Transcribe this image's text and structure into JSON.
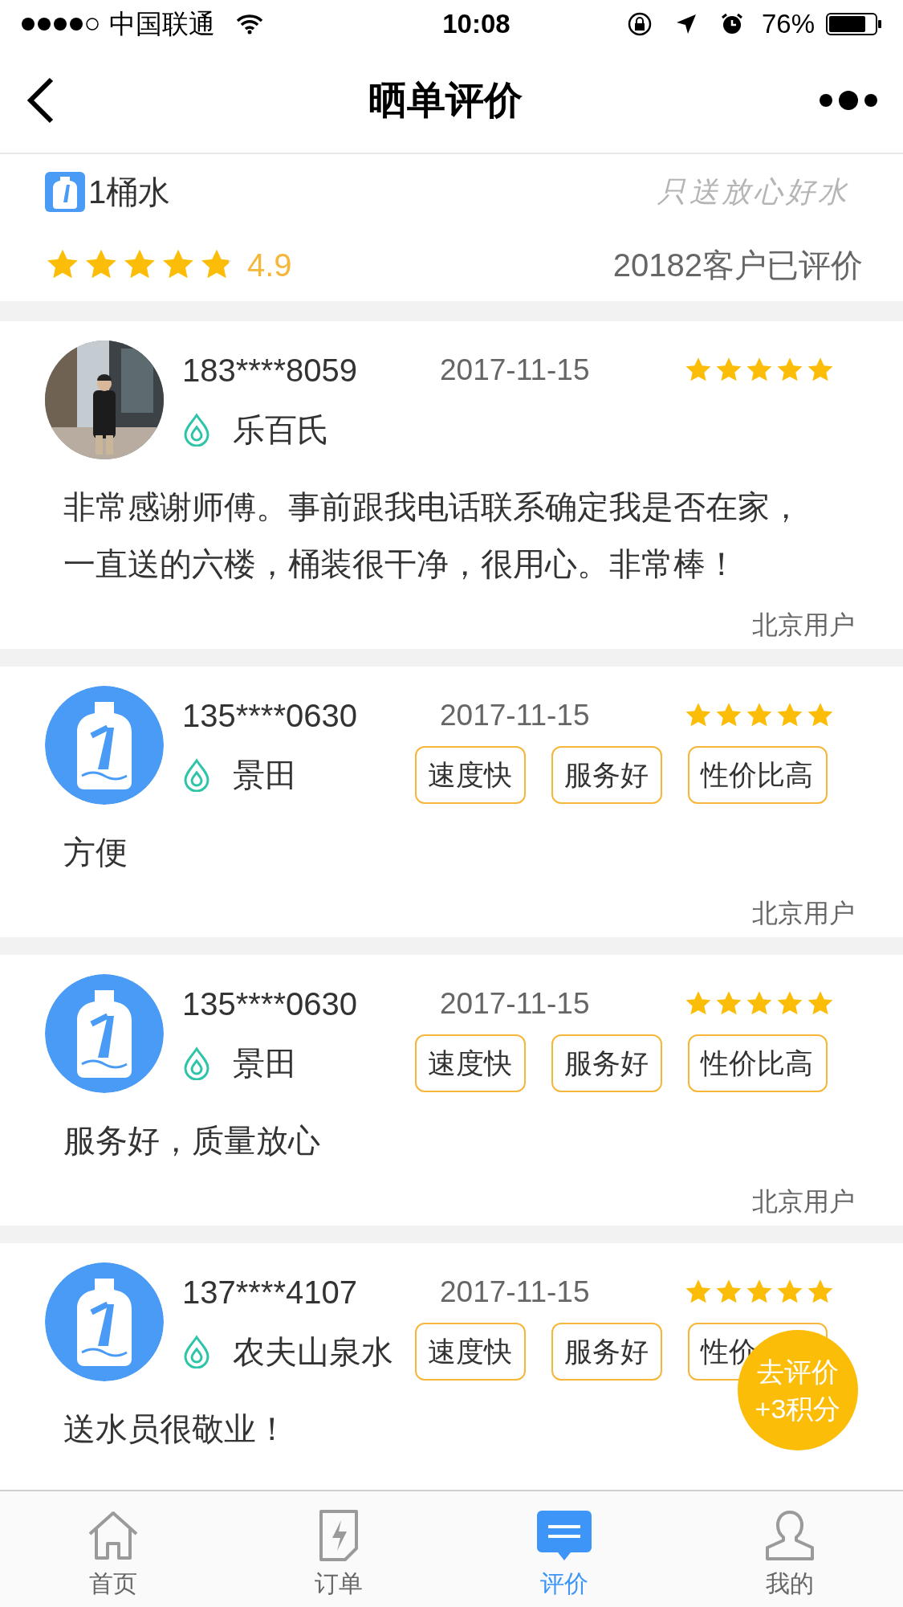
{
  "status_bar": {
    "carrier": "中国联通",
    "time": "10:08",
    "battery": "76%"
  },
  "nav": {
    "title": "晒单评价"
  },
  "shop": {
    "name": "1桶水",
    "slogan": "只送放心好水",
    "stars": 4.9,
    "rating": "4.9",
    "review_count": "20182客户已评价"
  },
  "reviews": [
    {
      "phone": "183****8059",
      "date": "2017-11-15",
      "stars": 5,
      "brand": "乐百氏",
      "comment": "非常感谢师傅。事前跟我电话联系确定我是否在家，一直送的六楼，桶装很干净，很用心。非常棒！",
      "location": "北京用户"
    },
    {
      "avatar": {
        "kind": "logo"
      },
      "phone": "135****0630",
      "date": "2017-11-15",
      "stars": 5,
      "brand": "景田",
      "tags": [
        "速度快",
        "服务好",
        "性价比高"
      ],
      "comment": "方便",
      "location": "北京用户"
    },
    {
      "avatar": {
        "kind": "logo"
      },
      "phone": "135****0630",
      "date": "2017-11-15",
      "stars": 5,
      "brand": "景田",
      "tags": [
        "速度快",
        "服务好",
        "性价比高"
      ],
      "comment": "服务好，质量放心",
      "location": "北京用户"
    },
    {
      "avatar": {
        "kind": "logo"
      },
      "phone": "137****4107",
      "date": "2017-11-15",
      "stars": 5,
      "brand": "农夫山泉水",
      "tags": [
        "速度快",
        "服务好",
        "性价"
      ],
      "comment": "送水员很敬业！"
    }
  ],
  "fab": {
    "lines": [
      "去评价",
      "+3积分"
    ]
  },
  "tab_bar": [
    {
      "label": "首页",
      "selected": false
    },
    {
      "label": "订单",
      "selected": false
    },
    {
      "label": "评价",
      "selected": true
    },
    {
      "label": "我的",
      "selected": false
    }
  ]
}
